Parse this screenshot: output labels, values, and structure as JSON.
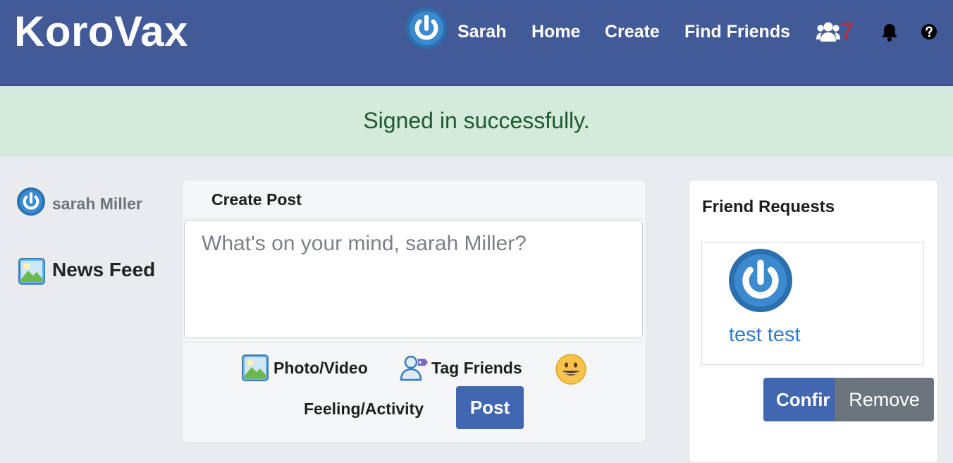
{
  "navbar": {
    "brand": "KoroVax",
    "user_link": "Sarah",
    "links": [
      "Home",
      "Create",
      "Find Friends"
    ],
    "friend_requests_count": "7",
    "icons": [
      "power-avatar-icon",
      "users-icon",
      "bell-icon",
      "question-circle-icon"
    ]
  },
  "flash": {
    "message": "Signed in successfully."
  },
  "sidebar": {
    "user_name": "sarah Miller",
    "news_feed_label": "News Feed"
  },
  "create_post": {
    "title": "Create Post",
    "placeholder": "What's on your mind, sarah Miller?",
    "photo_video_label": "Photo/Video",
    "tag_friends_label": "Tag Friends",
    "feeling_activity_label": "Feeling/Activity",
    "post_button_label": "Post"
  },
  "friend_requests": {
    "title": "Friend Requests",
    "items": [
      {
        "name": "test test",
        "confirm_label": "Confir",
        "remove_label": "Remove"
      }
    ]
  },
  "colors": {
    "navbar_bg": "#425a98",
    "flash_bg": "#d4eadb",
    "flash_text": "#1e5a30",
    "primary_button": "#4267b2",
    "secondary_button": "#6c757d",
    "count_badge": "#c8262c",
    "link": "#2e7bd6",
    "page_bg": "#e9ebee"
  }
}
